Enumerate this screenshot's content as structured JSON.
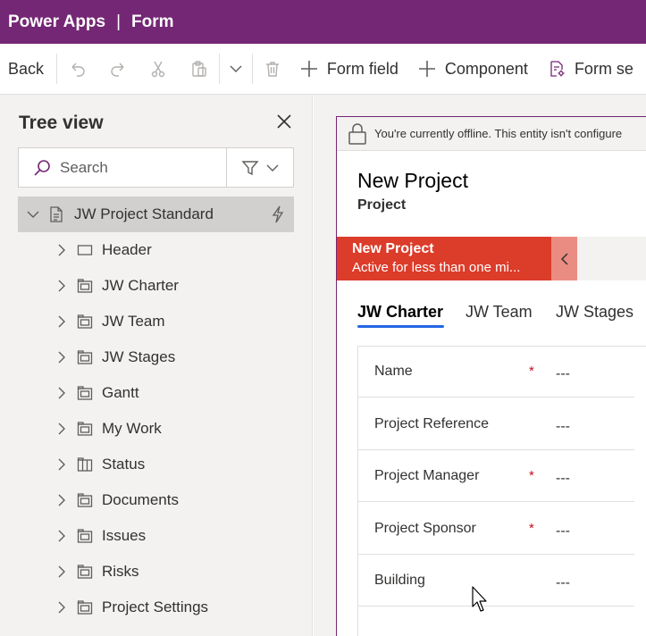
{
  "app": {
    "name": "Power Apps",
    "separator": "|",
    "page": "Form"
  },
  "toolbar": {
    "back": "Back",
    "form_field": "Form field",
    "component": "Component",
    "form_settings": "Form se"
  },
  "tree_view": {
    "title": "Tree view",
    "search_placeholder": "Search",
    "root": "JW Project Standard",
    "items": [
      {
        "label": "Header",
        "icon": "header-icon"
      },
      {
        "label": "JW Charter",
        "icon": "tab-icon"
      },
      {
        "label": "JW Team",
        "icon": "tab-icon"
      },
      {
        "label": "JW Stages",
        "icon": "tab-icon"
      },
      {
        "label": "Gantt",
        "icon": "tab-icon"
      },
      {
        "label": "My Work",
        "icon": "tab-icon"
      },
      {
        "label": "Status",
        "icon": "tab-columns-icon"
      },
      {
        "label": "Documents",
        "icon": "tab-icon"
      },
      {
        "label": "Issues",
        "icon": "tab-icon"
      },
      {
        "label": "Risks",
        "icon": "tab-icon"
      },
      {
        "label": "Project Settings",
        "icon": "tab-icon"
      }
    ]
  },
  "form_preview": {
    "offline_message": "You're currently offline. This entity isn't configure",
    "record_title": "New Project",
    "record_subtitle": "Project",
    "bpf": {
      "stage_name": "New Project",
      "stage_status": "Active for less than one mi..."
    },
    "tabs": [
      "JW Charter",
      "JW Team",
      "JW Stages"
    ],
    "active_tab": "JW Charter",
    "fields": [
      {
        "label": "Name",
        "required": true,
        "value": "---"
      },
      {
        "label": "Project Reference",
        "required": false,
        "value": "---"
      },
      {
        "label": "Project Manager",
        "required": true,
        "value": "---"
      },
      {
        "label": "Project Sponsor",
        "required": true,
        "value": "---"
      },
      {
        "label": "Building",
        "required": false,
        "value": "---"
      }
    ],
    "required_marker": "*"
  },
  "colors": {
    "brand": "#742774",
    "stage": "#dc3c2a",
    "tab_underline": "#2266e3",
    "required": "#c50f1f"
  }
}
